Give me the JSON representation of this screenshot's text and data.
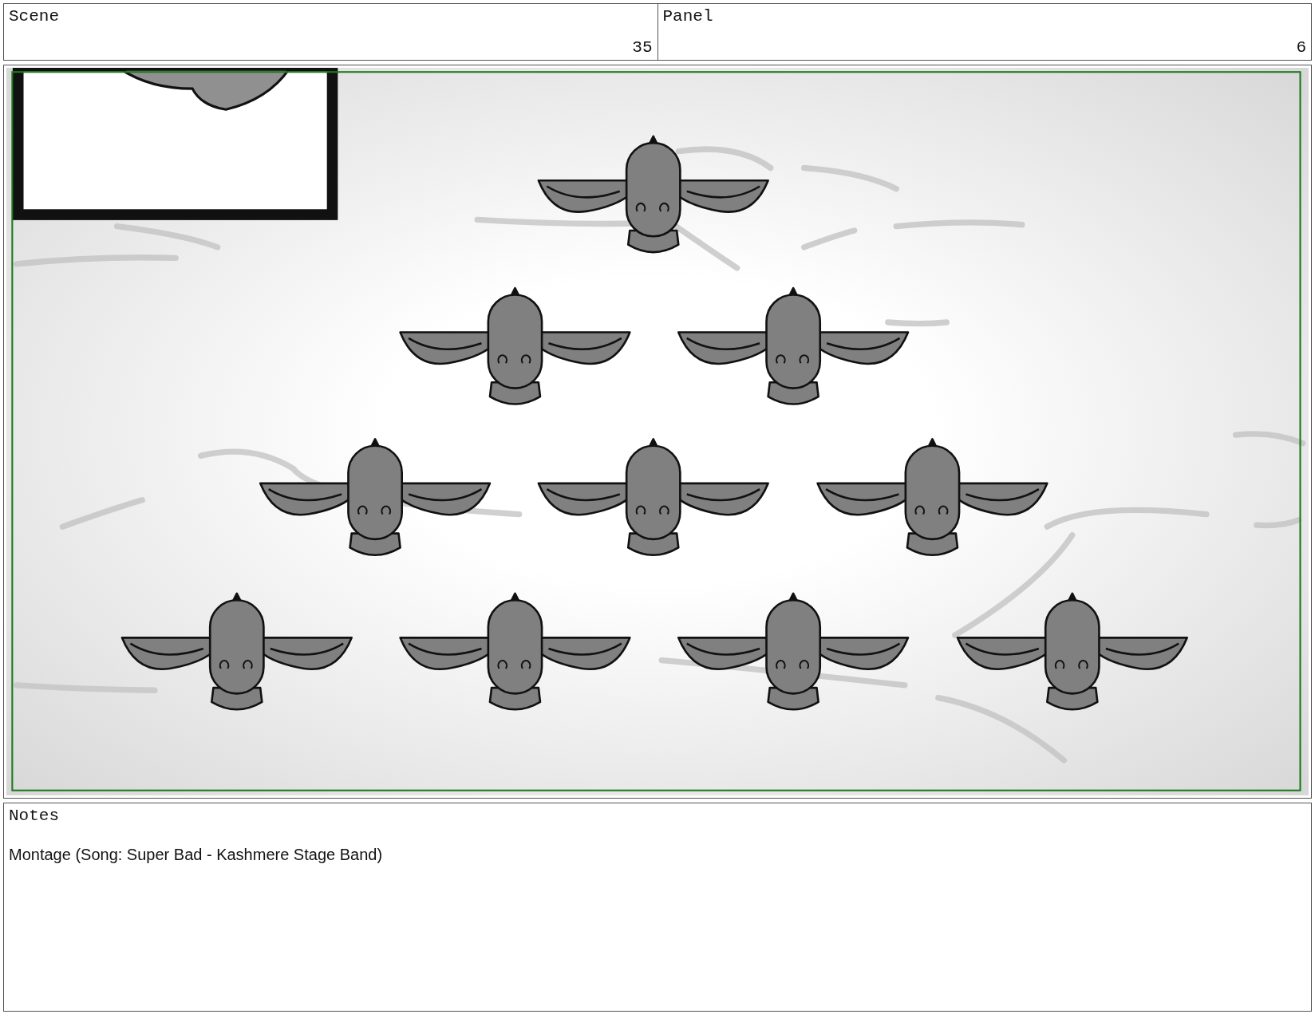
{
  "header": {
    "scene": {
      "label": "Scene",
      "value": "35"
    },
    "panel": {
      "label": "Panel",
      "value": "6"
    }
  },
  "notes": {
    "label": "Notes",
    "text": "Montage (Song: Super Bad - Kashmere Stage Band)"
  }
}
